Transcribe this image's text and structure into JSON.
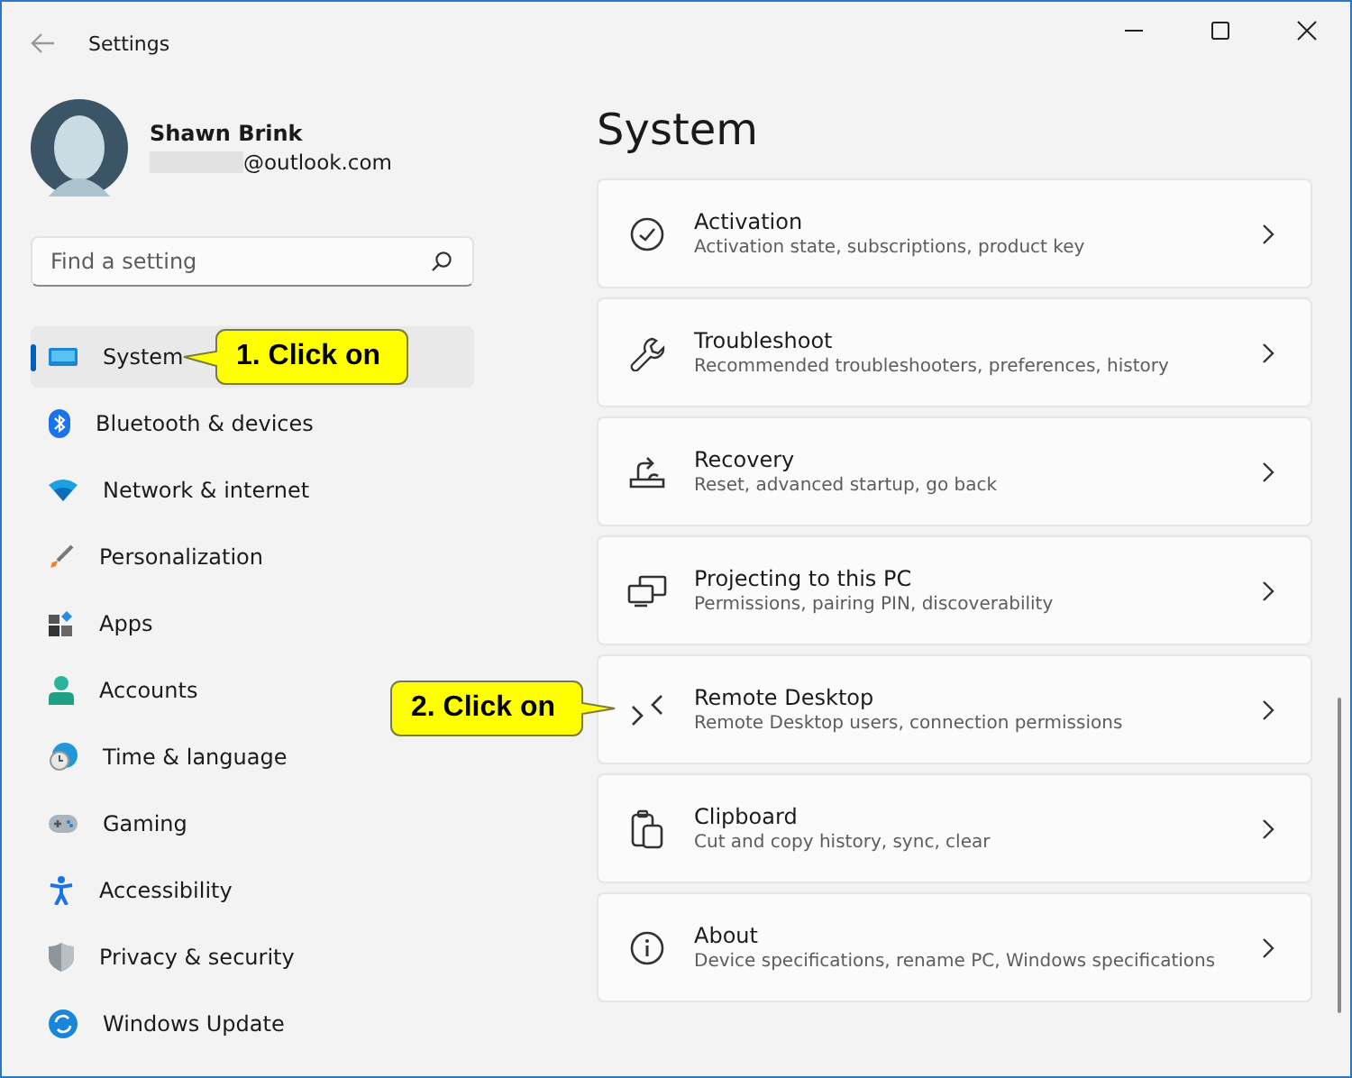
{
  "window": {
    "title": "Settings"
  },
  "profile": {
    "name": "Shawn Brink",
    "email": "@outlook.com"
  },
  "search": {
    "placeholder": "Find a setting"
  },
  "sidebar": {
    "items": [
      {
        "label": "System",
        "selected": true,
        "callout": "1. Click on"
      },
      {
        "label": "Bluetooth & devices",
        "selected": false
      },
      {
        "label": "Network & internet",
        "selected": false
      },
      {
        "label": "Personalization",
        "selected": false
      },
      {
        "label": "Apps",
        "selected": false
      },
      {
        "label": "Accounts",
        "selected": false
      },
      {
        "label": "Time & language",
        "selected": false
      },
      {
        "label": "Gaming",
        "selected": false
      },
      {
        "label": "Accessibility",
        "selected": false
      },
      {
        "label": "Privacy & security",
        "selected": false
      },
      {
        "label": "Windows Update",
        "selected": false
      }
    ]
  },
  "page": {
    "title": "System",
    "cards": [
      {
        "title": "Activation",
        "subtitle": "Activation state, subscriptions, product key"
      },
      {
        "title": "Troubleshoot",
        "subtitle": "Recommended troubleshooters, preferences, history"
      },
      {
        "title": "Recovery",
        "subtitle": "Reset, advanced startup, go back"
      },
      {
        "title": "Projecting to this PC",
        "subtitle": "Permissions, pairing PIN, discoverability"
      },
      {
        "title": "Remote Desktop",
        "subtitle": "Remote Desktop users, connection permissions",
        "callout": "2. Click on"
      },
      {
        "title": "Clipboard",
        "subtitle": "Cut and copy history, sync, clear"
      },
      {
        "title": "About",
        "subtitle": "Device specifications, rename PC, Windows specifications"
      }
    ]
  }
}
